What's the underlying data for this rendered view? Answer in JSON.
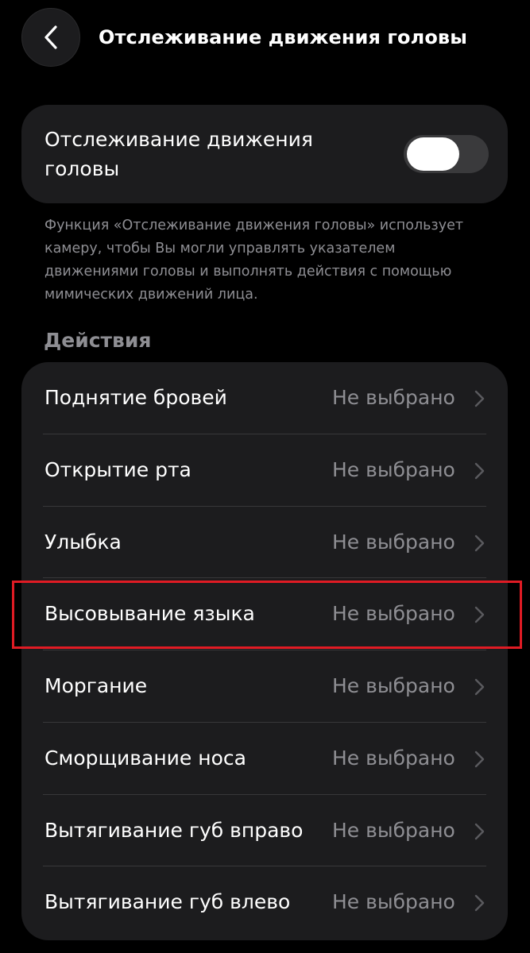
{
  "header": {
    "title": "Отслеживание движения головы",
    "back_icon": "chevron-left-icon"
  },
  "main_toggle": {
    "label": "Отслеживание движения головы",
    "state": "off"
  },
  "description": "Функция «Отслеживание движения головы» использует камеру, чтобы Вы могли управлять указателем движениями головы и выполнять действия с помощью мимических движений лица.",
  "actions": {
    "title": "Действия",
    "items": [
      {
        "label": "Поднятие бровей",
        "value": "Не выбрано"
      },
      {
        "label": "Открытие рта",
        "value": "Не выбрано"
      },
      {
        "label": "Улыбка",
        "value": "Не выбрано"
      },
      {
        "label": "Высовывание языка",
        "value": "Не выбрано"
      },
      {
        "label": "Моргание",
        "value": "Не выбрано"
      },
      {
        "label": "Сморщивание носа",
        "value": "Не выбрано"
      },
      {
        "label": "Вытягивание губ вправо",
        "value": "Не выбрано"
      },
      {
        "label": "Вытягивание губ влево",
        "value": "Не выбрано"
      }
    ],
    "highlighted_index": 3
  },
  "colors": {
    "background": "#000000",
    "card": "#1c1c1e",
    "secondary_text": "#8e8e93",
    "highlight": "#e01b24"
  }
}
